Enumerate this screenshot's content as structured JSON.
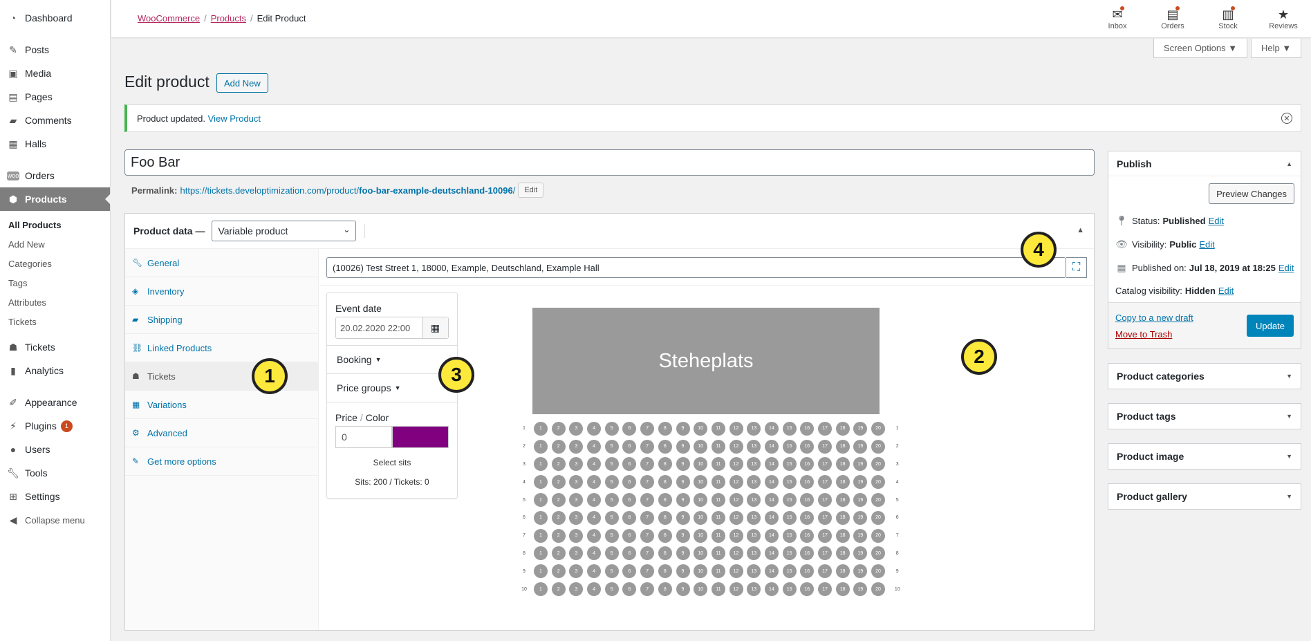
{
  "sidebar": {
    "items": [
      {
        "label": "Dashboard",
        "icon": "dashboard-icon"
      },
      {
        "label": "Posts",
        "icon": "pin-icon"
      },
      {
        "label": "Media",
        "icon": "media-icon"
      },
      {
        "label": "Pages",
        "icon": "pages-icon"
      },
      {
        "label": "Comments",
        "icon": "comments-icon"
      },
      {
        "label": "Halls",
        "icon": "grid-icon"
      },
      {
        "label": "Orders",
        "icon": "woo-icon"
      },
      {
        "label": "Products",
        "icon": "box-icon"
      },
      {
        "label": "Tickets",
        "icon": "ticket-icon"
      },
      {
        "label": "Analytics",
        "icon": "chart-icon"
      },
      {
        "label": "Appearance",
        "icon": "brush-icon"
      },
      {
        "label": "Plugins",
        "icon": "plug-icon",
        "badge": "1"
      },
      {
        "label": "Users",
        "icon": "user-icon"
      },
      {
        "label": "Tools",
        "icon": "wrench-icon"
      },
      {
        "label": "Settings",
        "icon": "settings-icon"
      },
      {
        "label": "Collapse menu",
        "icon": "collapse-icon"
      }
    ],
    "submenu": [
      "All Products",
      "Add New",
      "Categories",
      "Tags",
      "Attributes",
      "Tickets"
    ]
  },
  "breadcrumb": {
    "woocommerce": "WooCommerce",
    "products": "Products",
    "current": "Edit Product"
  },
  "top_icons": [
    {
      "label": "Inbox",
      "icon": "inbox-icon"
    },
    {
      "label": "Orders",
      "icon": "orders-icon"
    },
    {
      "label": "Stock",
      "icon": "stock-icon"
    },
    {
      "label": "Reviews",
      "icon": "star-icon"
    }
  ],
  "screen_options": "Screen Options ▼",
  "help": "Help ▼",
  "page": {
    "title": "Edit product",
    "add_new": "Add New"
  },
  "notice": {
    "text": "Product updated.",
    "link": "View Product"
  },
  "product_title": "Foo Bar",
  "permalink": {
    "label": "Permalink:",
    "url_base": "https://tickets.developtimization.com/product/",
    "slug": "foo-bar-example-deutschland-10096",
    "url_end": "/",
    "edit": "Edit"
  },
  "product_data": {
    "label": "Product data —",
    "type": "Variable product",
    "tabs": [
      "General",
      "Inventory",
      "Shipping",
      "Linked Products",
      "Tickets",
      "Variations",
      "Advanced",
      "Get more options"
    ],
    "active_tab": "Tickets"
  },
  "tickets": {
    "hall": "(10026) Test Street 1, 18000, Example, Deutschland, Example Hall",
    "event_date_label": "Event date",
    "event_date": "20.02.2020 22:00",
    "booking": "Booking",
    "price_groups": "Price groups",
    "price_label": "Price",
    "color_label": "Color",
    "price_value": "0",
    "color_value": "#800080",
    "select_sits": "Select sits",
    "sits_count": "Sits: 200 / Tickets: 0",
    "stage_label": "Steheplats",
    "rows": [
      "1",
      "2",
      "3",
      "4",
      "5",
      "6",
      "7",
      "8",
      "9",
      "10"
    ],
    "seats": [
      "1",
      "2",
      "3",
      "4",
      "5",
      "6",
      "7",
      "8",
      "9",
      "10",
      "11",
      "12",
      "13",
      "14",
      "15",
      "16",
      "17",
      "18",
      "19",
      "20"
    ]
  },
  "publish": {
    "title": "Publish",
    "preview": "Preview Changes",
    "status_label": "Status:",
    "status": "Published",
    "visibility_label": "Visibility:",
    "visibility": "Public",
    "published_label": "Published on:",
    "published": "Jul 18, 2019 at 18:25",
    "catalog_label": "Catalog visibility:",
    "catalog": "Hidden",
    "edit": "Edit",
    "copy_draft": "Copy to a new draft",
    "trash": "Move to Trash",
    "update": "Update"
  },
  "side_boxes": [
    "Product categories",
    "Product tags",
    "Product image",
    "Product gallery"
  ],
  "callouts": [
    "1",
    "2",
    "3",
    "4"
  ],
  "colors": {
    "accent": "#0073aa",
    "active_menu": "#7e7e7e",
    "notice": "#46b450",
    "callout": "#fde93b",
    "update": "#0085ba"
  }
}
